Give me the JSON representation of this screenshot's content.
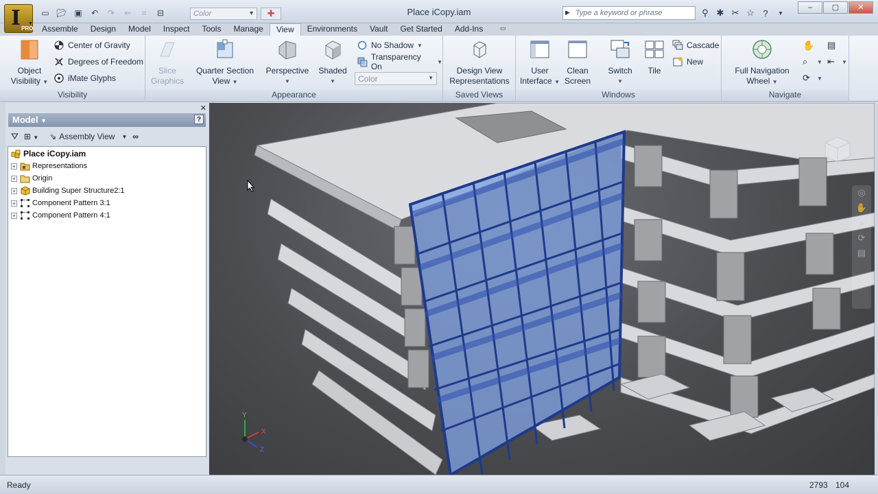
{
  "titlebar": {
    "document_title": "Place iCopy.iam",
    "app_badge": "PRO",
    "color_combo": "Color",
    "search_placeholder": "Type a keyword or phrase"
  },
  "tabs": [
    "Assemble",
    "Design",
    "Model",
    "Inspect",
    "Tools",
    "Manage",
    "View",
    "Environments",
    "Vault",
    "Get Started",
    "Add-Ins"
  ],
  "active_tab": "View",
  "ribbon": {
    "visibility": {
      "title": "Visibility",
      "object_visibility_line1": "Object",
      "object_visibility_line2": "Visibility",
      "center_of_gravity": "Center of Gravity",
      "degrees_of_freedom": "Degrees of Freedom",
      "imate_glyphs": "iMate Glyphs"
    },
    "appearance": {
      "title": "Appearance",
      "slice_line1": "Slice",
      "slice_line2": "Graphics",
      "quarter_line1": "Quarter Section",
      "quarter_line2": "View",
      "perspective": "Perspective",
      "shaded": "Shaded",
      "no_shadow": "No Shadow",
      "transparency_on": "Transparency On",
      "color_select": "Color"
    },
    "saved_views": {
      "title": "Saved Views",
      "design_line1": "Design View",
      "design_line2": "Representations"
    },
    "windows": {
      "title": "Windows",
      "user_line1": "User",
      "user_line2": "Interface",
      "clean_line1": "Clean",
      "clean_line2": "Screen",
      "switch": "Switch",
      "tile": "Tile",
      "cascade": "Cascade",
      "new": "New"
    },
    "navigate": {
      "title": "Navigate",
      "wheel_line1": "Full Navigation",
      "wheel_line2": "Wheel"
    }
  },
  "browser": {
    "title": "Model",
    "view_mode": "Assembly View",
    "tree": [
      {
        "label": "Place iCopy.iam",
        "root": true,
        "icon": "assembly-icon"
      },
      {
        "label": "Representations",
        "icon": "representations-folder-icon"
      },
      {
        "label": "Origin",
        "icon": "origin-folder-icon"
      },
      {
        "label": "Building Super Structure2:1",
        "icon": "subassembly-icon"
      },
      {
        "label": "Component Pattern 3:1",
        "icon": "pattern-icon"
      },
      {
        "label": "Component Pattern 4:1",
        "icon": "pattern-icon"
      }
    ]
  },
  "viewport": {
    "axis_x": "X",
    "axis_y": "Y",
    "axis_z": "Z"
  },
  "statusbar": {
    "status": "Ready",
    "count_a": "2793",
    "count_b": "104"
  },
  "colors": {
    "glass": "#7fa0e0",
    "mullion": "#1f3a8a",
    "slab": "#d4d6da",
    "column": "#9a9ca0",
    "background": "#4a4c50",
    "ribbon_active": "#eef2f8"
  }
}
